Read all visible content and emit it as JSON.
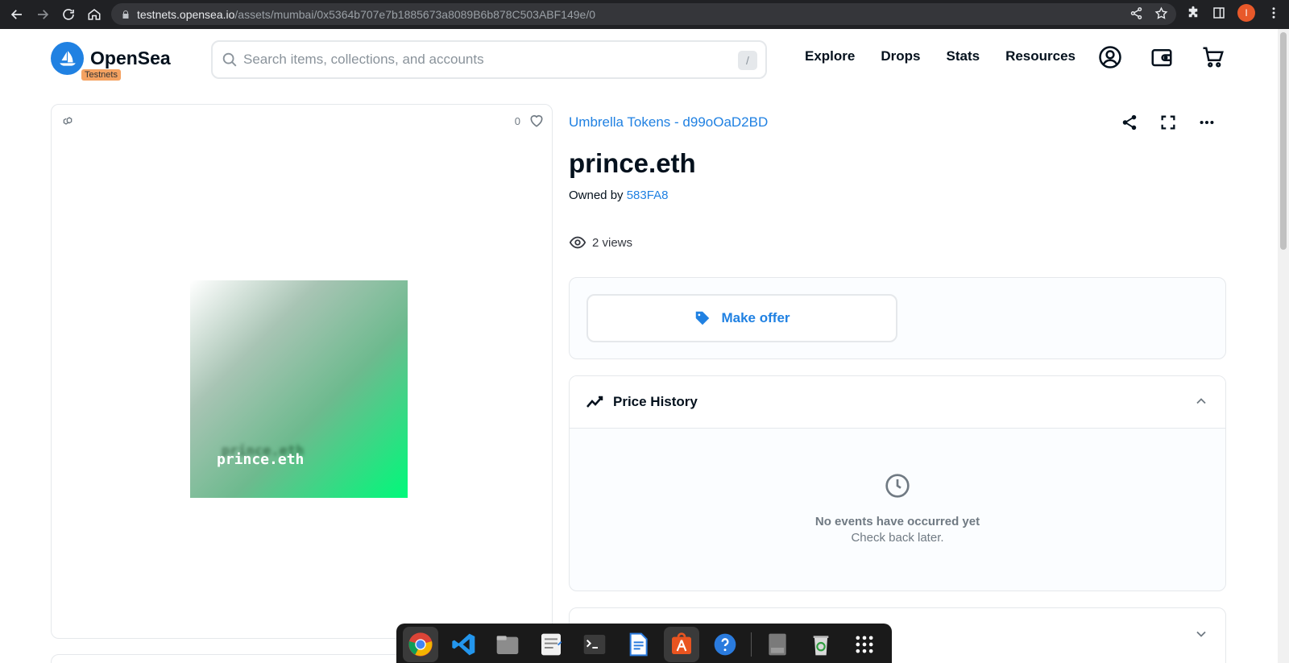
{
  "browser": {
    "url_domain": "testnets.opensea.io",
    "url_path": "/assets/mumbai/0x5364b707e7b1885673a8089B6b878C503ABF149e/0",
    "profile_initial": "I"
  },
  "header": {
    "brand": "OpenSea",
    "badge": "Testnets",
    "search_placeholder": "Search items, collections, and accounts",
    "search_shortcut": "/",
    "nav": [
      "Explore",
      "Drops",
      "Stats",
      "Resources"
    ]
  },
  "asset": {
    "favorites_count": "0",
    "image_text": "prince.eth",
    "collection": "Umbrella Tokens - d99oOaD2BD",
    "title": "prince.eth",
    "owned_by_label": "Owned by",
    "owner": "583FA8",
    "views": "2 views"
  },
  "offer": {
    "button_label": "Make offer"
  },
  "price_history": {
    "title": "Price History",
    "empty_title": "No events have occurred yet",
    "empty_sub": "Check back later."
  },
  "colors": {
    "accent": "#2081e2",
    "badge": "#f4a261"
  },
  "dock": {
    "apps": [
      "chrome-icon",
      "vscode-icon",
      "files-icon",
      "text-editor-icon",
      "terminal-icon",
      "document-viewer-icon",
      "app-store-icon",
      "help-icon",
      "disk-icon",
      "trash-icon",
      "app-grid-icon"
    ]
  }
}
